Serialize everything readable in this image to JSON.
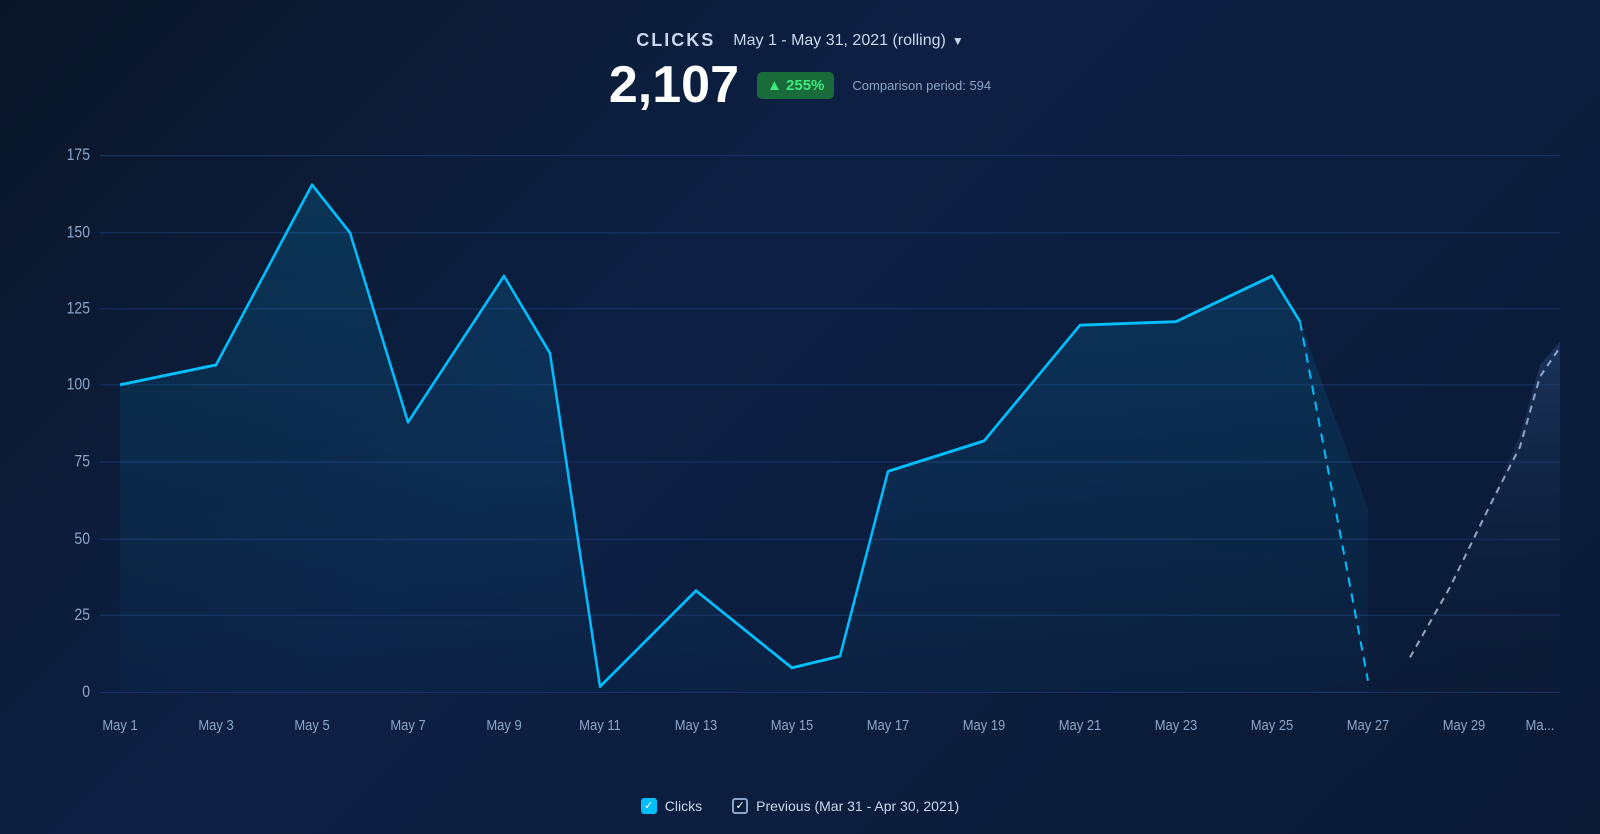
{
  "header": {
    "metric_title": "CLICKS",
    "date_range": "May 1 - May 31, 2021 (rolling)",
    "main_value": "2,107",
    "badge_text": "▲ 255%",
    "comparison_label": "Comparison period: 594"
  },
  "chart": {
    "y_labels": [
      "0",
      "25",
      "50",
      "75",
      "100",
      "125",
      "150",
      "175"
    ],
    "x_labels": [
      "May 1",
      "May 3",
      "May 5",
      "May 7",
      "May 9",
      "May 11",
      "May 13",
      "May 15",
      "May 17",
      "May 19",
      "May 21",
      "May 23",
      "May 25",
      "May 27",
      "May 29",
      "Ma..."
    ],
    "accent_color": "#00bfff",
    "prev_color": "#8aa5c8"
  },
  "legend": {
    "clicks_label": "Clicks",
    "previous_label": "Previous (Mar 31 - Apr 30, 2021)"
  }
}
